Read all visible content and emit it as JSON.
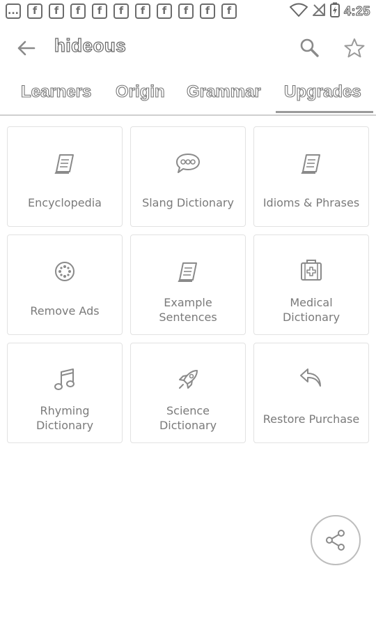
{
  "status_bar": {
    "notification_icons": [
      "...",
      "f",
      "f",
      "f",
      "f",
      "f",
      "f",
      "f",
      "f",
      "f",
      "f",
      "f"
    ],
    "time": "4:25"
  },
  "app_bar": {
    "title": "hideous"
  },
  "tabs": [
    {
      "label": "Learners"
    },
    {
      "label": "Origin"
    },
    {
      "label": "Grammar"
    },
    {
      "label": "Upgrades",
      "selected": true
    }
  ],
  "upgrades": [
    {
      "label": "Encyclopedia",
      "icon": "book-icon"
    },
    {
      "label": "Slang Dictionary",
      "icon": "speech-bubble-icon"
    },
    {
      "label": "Idioms & Phrases",
      "icon": "book-icon"
    },
    {
      "label": "Remove Ads",
      "icon": "remove-ads-icon"
    },
    {
      "label": "Example\nSentences",
      "icon": "book-icon"
    },
    {
      "label": "Medical\nDictionary",
      "icon": "medical-kit-icon"
    },
    {
      "label": "Rhyming\nDictionary",
      "icon": "music-note-icon"
    },
    {
      "label": "Science\nDictionary",
      "icon": "rocket-icon"
    },
    {
      "label": "Restore Purchase",
      "icon": "undo-arrow-icon"
    }
  ],
  "colors": {
    "icon_stroke": "#8a8a8a",
    "label_text": "#7a7a7a",
    "card_border": "#e2e2e2"
  }
}
